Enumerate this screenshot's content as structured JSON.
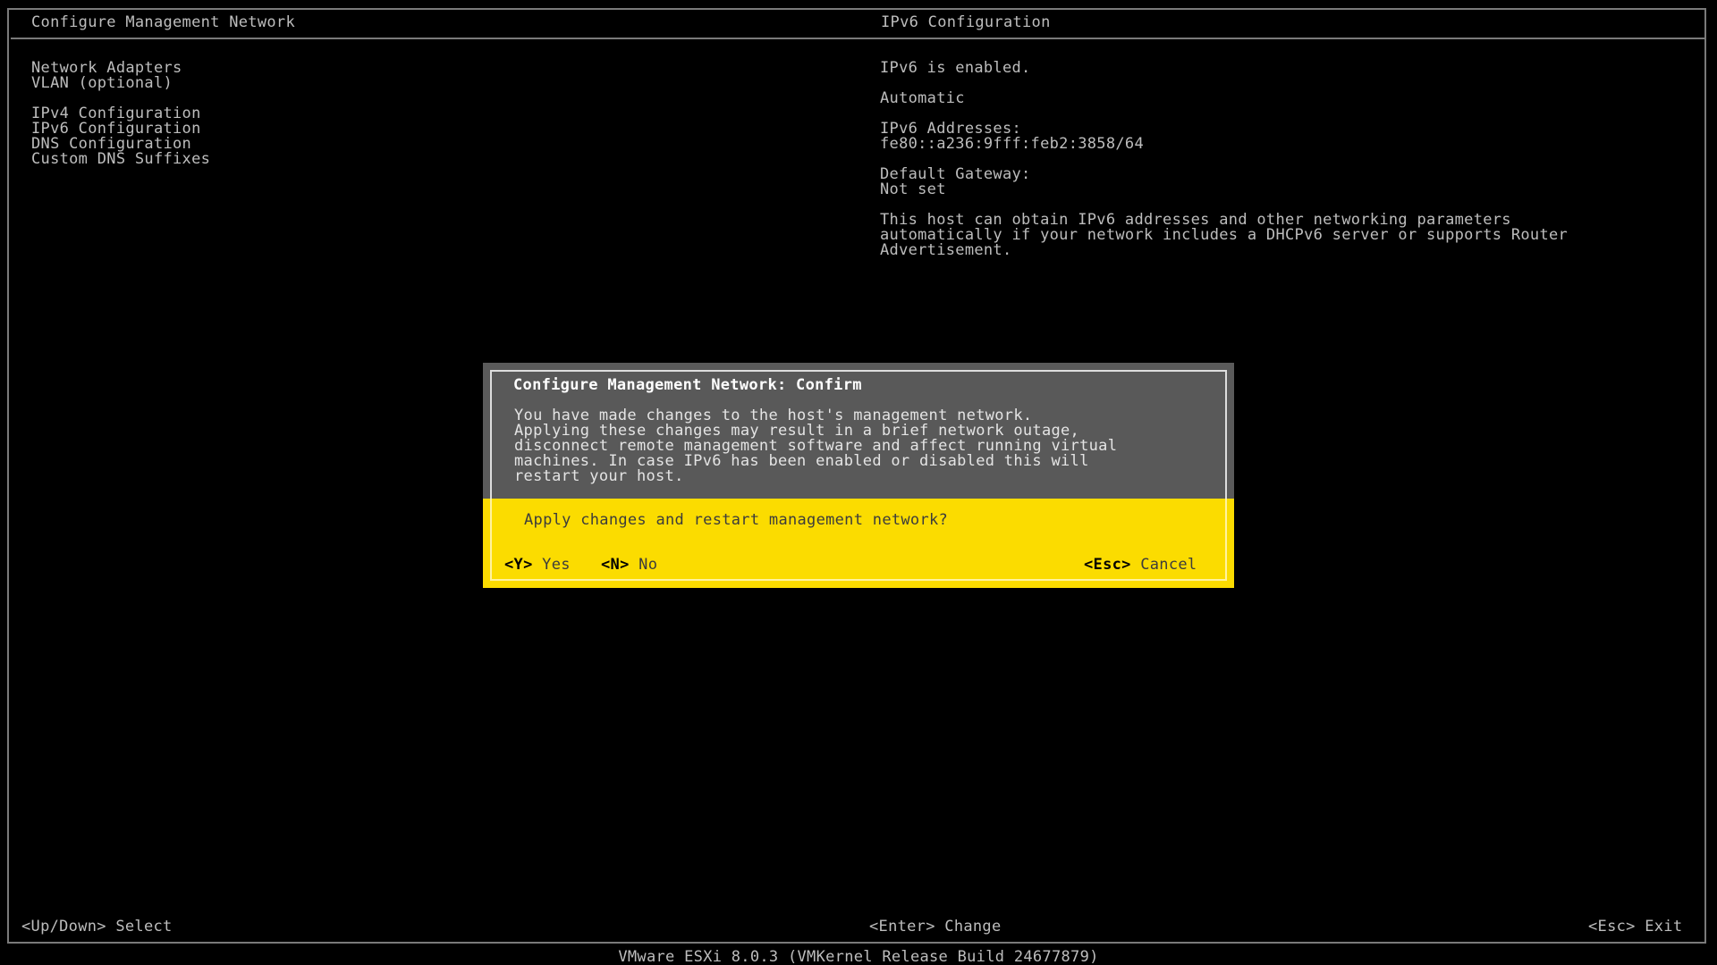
{
  "header": {
    "title": "Configure Management Network",
    "right_title": "IPv6 Configuration"
  },
  "menu": {
    "items": [
      "Network Adapters",
      "VLAN (optional)",
      "IPv4 Configuration",
      "IPv6 Configuration",
      "DNS Configuration",
      "Custom DNS Suffixes"
    ]
  },
  "detail": {
    "status": "IPv6 is enabled.",
    "mode": "Automatic",
    "addresses_label": "IPv6 Addresses:",
    "addresses_value": "fe80::a236:9fff:feb2:3858/64",
    "gateway_label": "Default Gateway:",
    "gateway_value": "Not set",
    "description_lines": [
      "This host can obtain IPv6 addresses and other networking parameters",
      "automatically if your network includes a DHCPv6 server or supports Router",
      "Advertisement."
    ]
  },
  "dialog": {
    "title": "Configure Management Network: Confirm",
    "body_lines": [
      "You have made changes to the host's management network.",
      "Applying these changes may result in a brief network outage,",
      "disconnect remote management software and affect running virtual",
      "machines. In case IPv6 has been enabled or disabled this will",
      "restart your host."
    ],
    "question": "Apply changes and restart management network?",
    "yes_key": "<Y>",
    "yes_label": "Yes",
    "no_key": "<N>",
    "no_label": "No",
    "cancel_key": "<Esc>",
    "cancel_label": "Cancel"
  },
  "footer": {
    "left": "<Up/Down> Select",
    "center": "<Enter> Change",
    "right": "<Esc> Exit",
    "version": "VMware ESXi 8.0.3 (VMKernel Release Build 24677879)"
  },
  "colors": {
    "background": "#000000",
    "text": "#bdbdbd",
    "dialog_bg": "#5a5a5a",
    "highlight": "#fbdc00"
  }
}
